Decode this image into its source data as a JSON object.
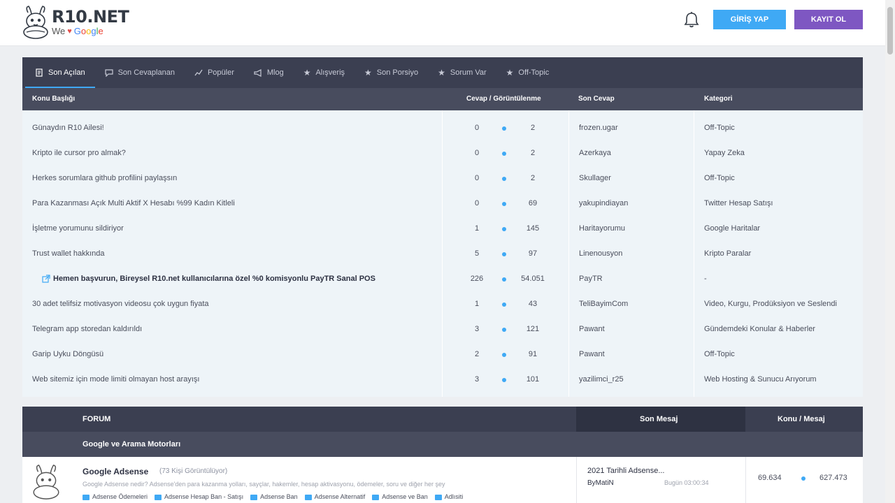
{
  "header": {
    "logo_main": "R10.NET",
    "logo_we": "We",
    "logo_google": [
      "G",
      "o",
      "o",
      "g",
      "l",
      "e"
    ],
    "login_label": "GİRİŞ YAP",
    "register_label": "KAYIT OL"
  },
  "tabs": [
    {
      "label": "Son Açılan",
      "icon": "document-icon",
      "active": true
    },
    {
      "label": "Son Cevaplanan",
      "icon": "chat-icon",
      "active": false
    },
    {
      "label": "Popüler",
      "icon": "trend-icon",
      "active": false
    },
    {
      "label": "Mlog",
      "icon": "megaphone-icon",
      "active": false
    },
    {
      "label": "Alışveriş",
      "icon": "star-icon",
      "active": false
    },
    {
      "label": "Son Porsiyo",
      "icon": "star-icon",
      "active": false
    },
    {
      "label": "Sorum Var",
      "icon": "star-icon",
      "active": false
    },
    {
      "label": "Off-Topic",
      "icon": "star-icon",
      "active": false
    }
  ],
  "columns": {
    "title": "Konu Başlığı",
    "stats": "Cevap / Görüntülenme",
    "last_reply": "Son Cevap",
    "category": "Kategori"
  },
  "topics": [
    {
      "title": "Günaydın R10 Ailesi!",
      "replies": "0",
      "views": "2",
      "user": "frozen.ugar",
      "category": "Off-Topic",
      "pinned": false
    },
    {
      "title": "Kripto ile cursor pro almak?",
      "replies": "0",
      "views": "2",
      "user": "Azerkaya",
      "category": "Yapay Zeka",
      "pinned": false
    },
    {
      "title": "Herkes sorumlara github profilini paylaşsın",
      "replies": "0",
      "views": "2",
      "user": "Skullager",
      "category": "Off-Topic",
      "pinned": false
    },
    {
      "title": "Para Kazanması Açık Multi Aktif X Hesabı %99 Kadın Kitleli",
      "replies": "0",
      "views": "69",
      "user": "yakupindiayan",
      "category": "Twitter Hesap Satışı",
      "pinned": false
    },
    {
      "title": "İşletme yorumunu sildiriyor",
      "replies": "1",
      "views": "145",
      "user": "Haritayorumu",
      "category": "Google Haritalar",
      "pinned": false
    },
    {
      "title": "Trust wallet hakkında",
      "replies": "5",
      "views": "97",
      "user": "Linenousyon",
      "category": "Kripto Paralar",
      "pinned": false
    },
    {
      "title": "Hemen başvurun, Bireysel R10.net kullanıcılarına özel %0 komisyonlu PayTR Sanal POS",
      "replies": "226",
      "views": "54.051",
      "user": "PayTR",
      "category": "-",
      "pinned": true
    },
    {
      "title": "30 adet telifsiz motivasyon videosu çok uygun fiyata",
      "replies": "1",
      "views": "43",
      "user": "TeliBayimCom",
      "category": "Video, Kurgu, Prodüksiyon ve Seslendi",
      "pinned": false
    },
    {
      "title": "Telegram app storedan kaldırıldı",
      "replies": "3",
      "views": "121",
      "user": "Pawant",
      "category": "Gündemdeki Konular & Haberler",
      "pinned": false
    },
    {
      "title": "Garip Uyku Döngüsü",
      "replies": "2",
      "views": "91",
      "user": "Pawant",
      "category": "Off-Topic",
      "pinned": false
    },
    {
      "title": "Web sitemiz için mode limiti olmayan host arayışı",
      "replies": "3",
      "views": "101",
      "user": "yazilimci_r25",
      "category": "Web Hosting & Sunucu Arıyorum",
      "pinned": false
    }
  ],
  "forum": {
    "col_forum": "FORUM",
    "col_last": "Son Mesaj",
    "col_stats": "Konu / Mesaj",
    "section": "Google ve Arama Motorları",
    "item": {
      "title": "Google Adsense",
      "viewers": "(73 Kişi Görüntülüyor)",
      "description": "Google Adsense nedir? Adsense'den para kazanma yolları, sayçlar, hakemler, hesap aktivasyonu, ödemeler, soru ve diğer her şey",
      "subforums": [
        "Adsense Ödemeleri",
        "Adsense Hesap Ban - Satışı",
        "Adsense Ban",
        "Adsense Alternatif",
        "Adsense ve Ban",
        "Adlısiti"
      ],
      "last_title": "2021 Tarihli Adsense...",
      "last_user": "ByMatiN",
      "last_date": "Bugün 03:00:34",
      "topics": "69.634",
      "posts": "627.473"
    }
  },
  "colors": {
    "tab_bg": "#3b3f51",
    "accent": "#3fa9f5",
    "register": "#7e57c2"
  }
}
